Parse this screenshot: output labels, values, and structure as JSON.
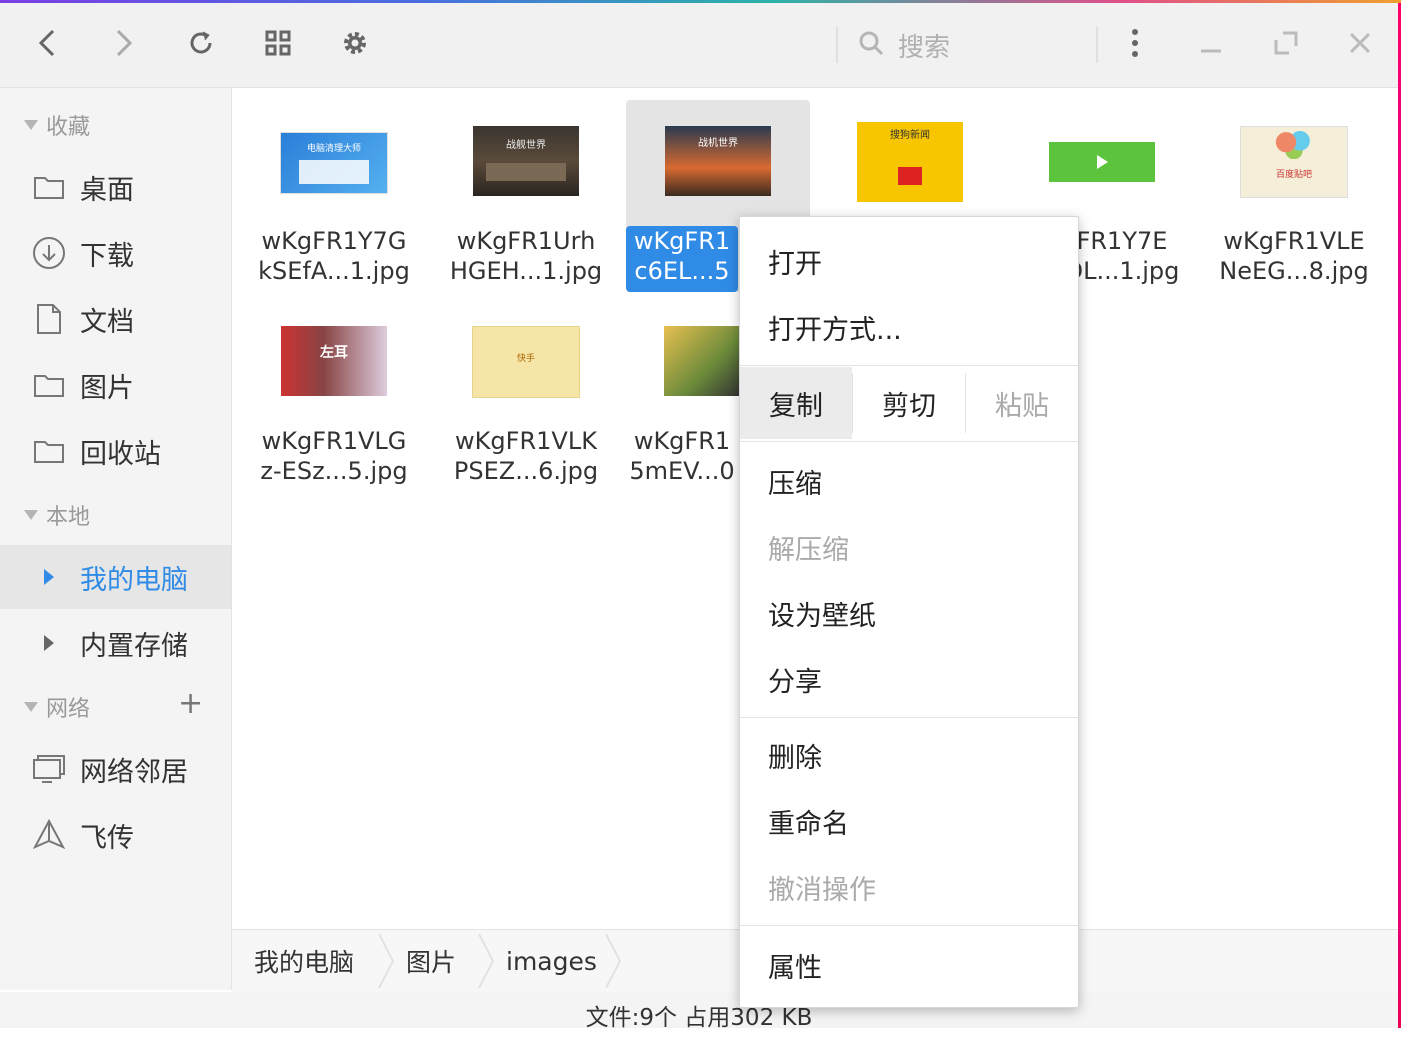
{
  "toolbar": {
    "search_placeholder": "搜索",
    "icons": [
      "back-icon",
      "forward-icon",
      "refresh-icon",
      "grid-view-icon",
      "settings-icon",
      "more-icon",
      "minimize-icon",
      "maximize-icon",
      "close-icon"
    ]
  },
  "sidebar": {
    "favorites_header": "收藏",
    "favorites": [
      {
        "label": "桌面",
        "icon": "folder-icon"
      },
      {
        "label": "下载",
        "icon": "download-icon"
      },
      {
        "label": "文档",
        "icon": "document-icon"
      },
      {
        "label": "图片",
        "icon": "folder-icon"
      },
      {
        "label": "回收站",
        "icon": "folder-icon"
      }
    ],
    "local_header": "本地",
    "local": [
      {
        "label": "我的电脑",
        "active": true
      },
      {
        "label": "内置存储",
        "active": false
      }
    ],
    "network_header": "网络",
    "network": [
      {
        "label": "网络邻居",
        "icon": "monitor-icon"
      },
      {
        "label": "飞传",
        "icon": "send-icon"
      }
    ]
  },
  "files": [
    {
      "line1": "wKgFR1Y7G",
      "line2": "kSEfA...1.jpg"
    },
    {
      "line1": "wKgFR1Urh",
      "line2": "HGEH...1.jpg"
    },
    {
      "line1": "wKgFR1",
      "line2": "c6EL...5"
    },
    {
      "line1": "",
      "line2": ""
    },
    {
      "line1": "FR1Y7E",
      "line2": "DL...1.jpg"
    },
    {
      "line1": "wKgFR1VLE",
      "line2": "NeEG...8.jpg"
    },
    {
      "line1": "wKgFR1VLG",
      "line2": "z-ESz...5.jpg"
    },
    {
      "line1": "wKgFR1VLK",
      "line2": "PSEZ...6.jpg"
    },
    {
      "line1": "wKgFR1",
      "line2": "5mEV...0"
    }
  ],
  "thumb_text": {
    "t1": "电脑清理大师",
    "t2": "战舰世界",
    "t3": "战机世界",
    "t4": "搜狗新闻",
    "t6": "百度贴吧",
    "t7": "左耳",
    "t8": "快手"
  },
  "context_menu": {
    "open": "打开",
    "open_with": "打开方式...",
    "copy": "复制",
    "cut": "剪切",
    "paste": "粘贴",
    "compress": "压缩",
    "decompress": "解压缩",
    "set_wallpaper": "设为壁纸",
    "share": "分享",
    "delete": "删除",
    "rename": "重命名",
    "undo": "撤消操作",
    "properties": "属性"
  },
  "breadcrumb": [
    "我的电脑",
    "图片",
    "images"
  ],
  "status": "文件:9个 占用302 KB",
  "colors": {
    "accent": "#2f8be6",
    "selected_tile": "#e4e4e4"
  }
}
